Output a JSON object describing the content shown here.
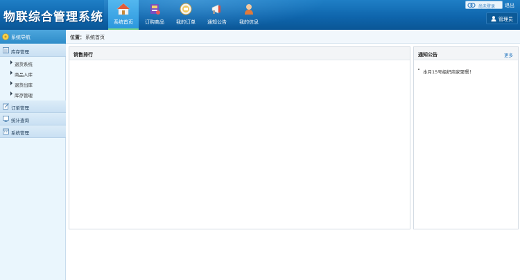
{
  "app": {
    "title": "物联综合管理系统"
  },
  "top_nav": [
    {
      "label": "系统首页",
      "icon": "home-icon",
      "active": true
    },
    {
      "label": "订购商品",
      "icon": "shopping-icon",
      "active": false
    },
    {
      "label": "我的订单",
      "icon": "orders-icon",
      "active": false
    },
    {
      "label": "通知公告",
      "icon": "megaphone-icon",
      "active": false
    },
    {
      "label": "我的信息",
      "icon": "profile-icon",
      "active": false
    }
  ],
  "header_right": {
    "login_text": "尚未登录",
    "logout_label": "退出",
    "user_label": "管理员"
  },
  "sidebar": {
    "header": "系统导航",
    "groups": [
      {
        "label": "库存管理",
        "icon": "inventory-icon",
        "items": [
          "退货系统",
          "商品入库",
          "退货出库",
          "库存管理"
        ]
      },
      {
        "label": "订单管理",
        "icon": "edit-icon"
      },
      {
        "label": "统计查询",
        "icon": "monitor-icon"
      },
      {
        "label": "系统管理",
        "icon": "calendar-icon"
      }
    ]
  },
  "breadcrumb": {
    "label": "位置：",
    "value": "系统首页"
  },
  "panels": {
    "sales": {
      "title": "销售排行"
    },
    "notice": {
      "title": "通知公告",
      "more": "更多",
      "items": [
        "本月15号组织商家聚餐！"
      ]
    }
  },
  "colors": {
    "header_dark": "#0a5696",
    "header_light": "#1f7fc6",
    "nav_active": "#2c97dd",
    "sidebar_bg": "#eaf6fd",
    "accent_green": "#6fd18b"
  }
}
